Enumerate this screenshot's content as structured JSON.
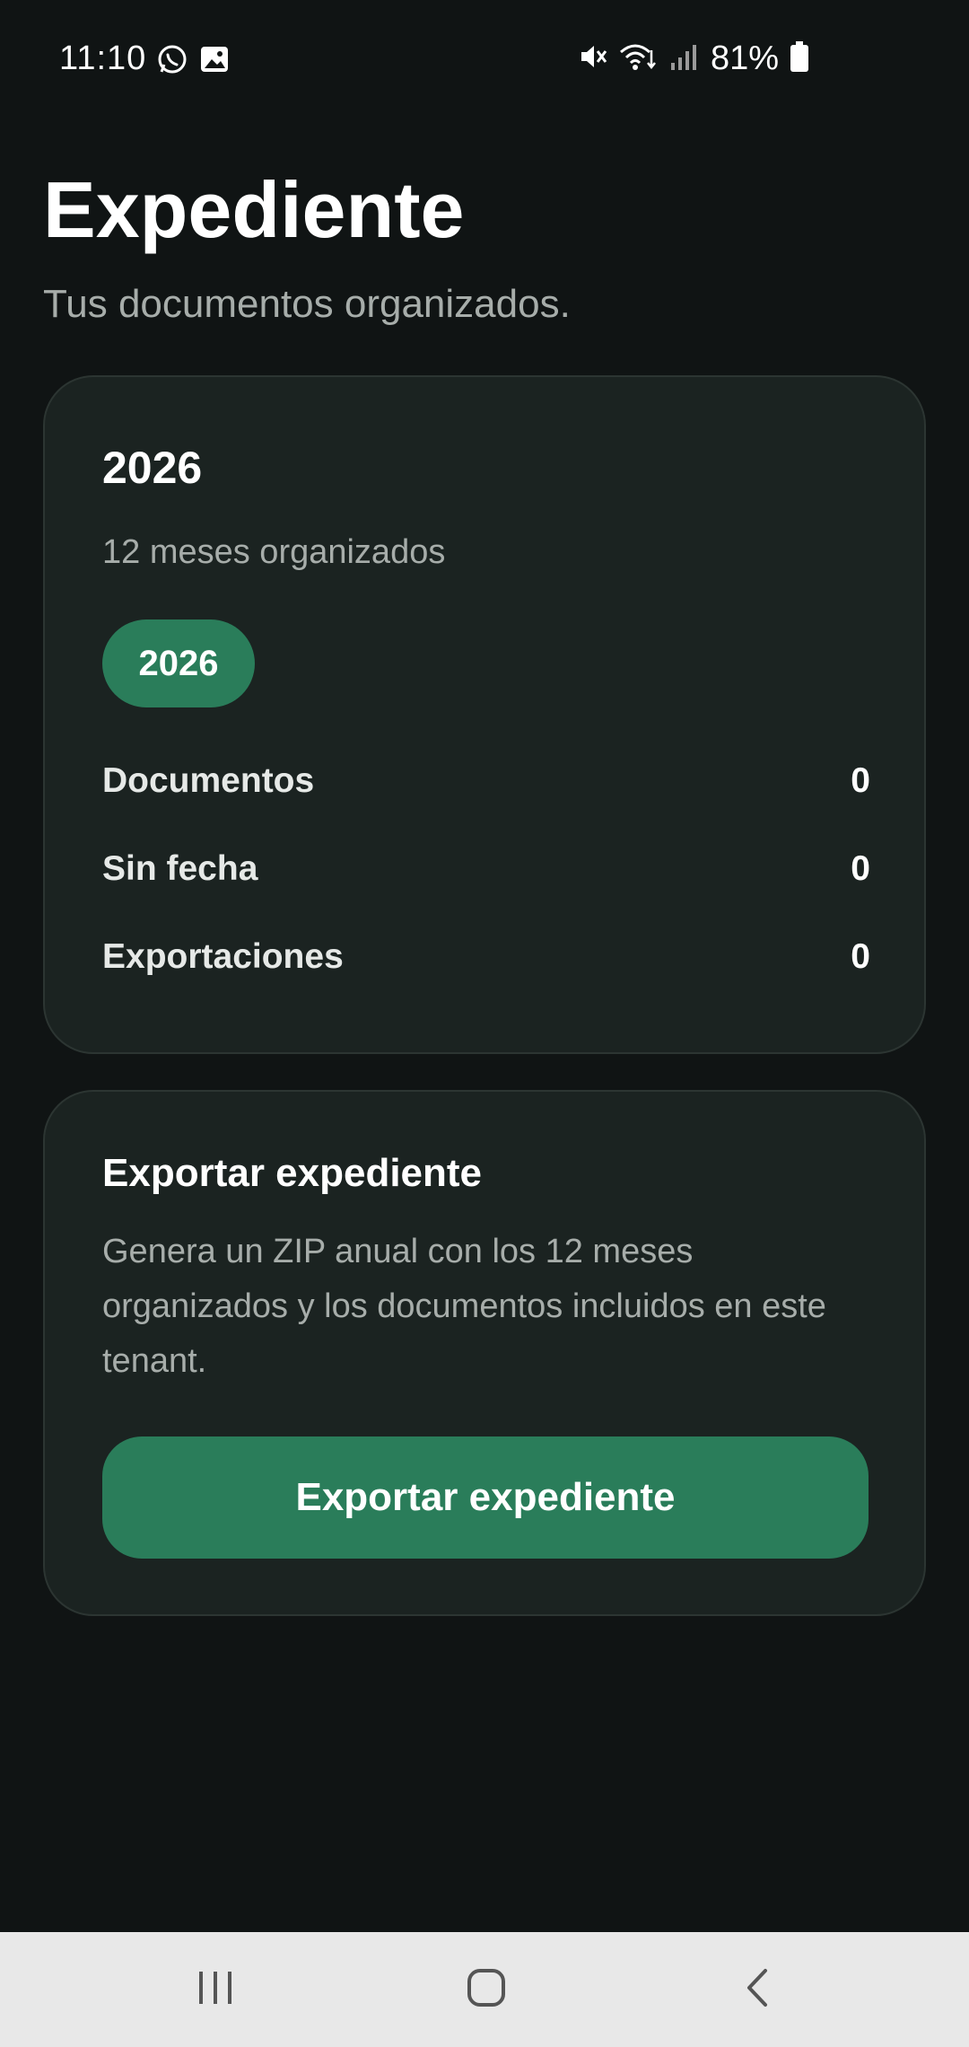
{
  "status_bar": {
    "time": "11:10",
    "battery_percent": "81%",
    "icons": [
      "whatsapp-icon",
      "gallery-icon",
      "mute-icon",
      "wifi-icon",
      "signal-icon",
      "battery-icon"
    ]
  },
  "header": {
    "title": "Expediente",
    "subtitle": "Tus documentos organizados."
  },
  "year_card": {
    "year": "2026",
    "subtitle": "12 meses organizados",
    "chip_label": "2026",
    "stats": [
      {
        "label": "Documentos",
        "value": "0"
      },
      {
        "label": "Sin fecha",
        "value": "0"
      },
      {
        "label": "Exportaciones",
        "value": "0"
      }
    ]
  },
  "export_card": {
    "title": "Exportar expediente",
    "description": "Genera un ZIP anual con los 12 meses organizados y los documentos incluidos en este tenant.",
    "button_label": "Exportar expediente"
  },
  "nav_bar": {
    "icons": [
      "recents-icon",
      "home-icon",
      "back-icon"
    ]
  },
  "colors": {
    "background": "#101414",
    "card": "#1b2321",
    "accent": "#2a7d5a",
    "muted_text": "#a7adaa"
  }
}
